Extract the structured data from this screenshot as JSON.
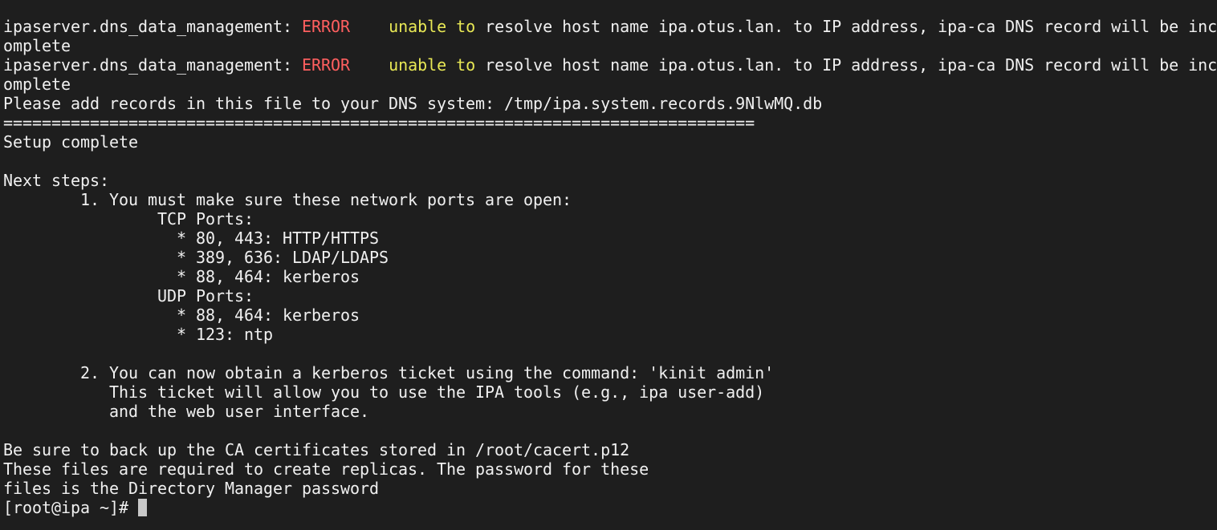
{
  "colors": {
    "background": "#1e1e1e",
    "foreground": "#f0f0f0",
    "error": "#ff5f5f",
    "warning": "#e8e855",
    "cursor": "#c8c8c8"
  },
  "lines": [
    {
      "type": "error",
      "prefix": "ipaserver.dns_data_management: ",
      "level": "ERROR",
      "gap": "    ",
      "warn": "unable to",
      "rest": " resolve host name ipa.otus.lan. to IP address, ipa-ca DNS record will be inc"
    },
    {
      "type": "plain",
      "text": "omplete"
    },
    {
      "type": "error",
      "prefix": "ipaserver.dns_data_management: ",
      "level": "ERROR",
      "gap": "    ",
      "warn": "unable to",
      "rest": " resolve host name ipa.otus.lan. to IP address, ipa-ca DNS record will be inc"
    },
    {
      "type": "plain",
      "text": "omplete"
    },
    {
      "type": "plain",
      "text": "Please add records in this file to your DNS system: /tmp/ipa.system.records.9NlwMQ.db"
    },
    {
      "type": "plain",
      "text": "=============================================================================="
    },
    {
      "type": "plain",
      "text": "Setup complete"
    },
    {
      "type": "plain",
      "text": ""
    },
    {
      "type": "plain",
      "text": "Next steps:"
    },
    {
      "type": "plain",
      "text": "        1. You must make sure these network ports are open:"
    },
    {
      "type": "plain",
      "text": "                TCP Ports:"
    },
    {
      "type": "plain",
      "text": "                  * 80, 443: HTTP/HTTPS"
    },
    {
      "type": "plain",
      "text": "                  * 389, 636: LDAP/LDAPS"
    },
    {
      "type": "plain",
      "text": "                  * 88, 464: kerberos"
    },
    {
      "type": "plain",
      "text": "                UDP Ports:"
    },
    {
      "type": "plain",
      "text": "                  * 88, 464: kerberos"
    },
    {
      "type": "plain",
      "text": "                  * 123: ntp"
    },
    {
      "type": "plain",
      "text": ""
    },
    {
      "type": "plain",
      "text": "        2. You can now obtain a kerberos ticket using the command: 'kinit admin'"
    },
    {
      "type": "plain",
      "text": "           This ticket will allow you to use the IPA tools (e.g., ipa user-add)"
    },
    {
      "type": "plain",
      "text": "           and the web user interface."
    },
    {
      "type": "plain",
      "text": ""
    },
    {
      "type": "plain",
      "text": "Be sure to back up the CA certificates stored in /root/cacert.p12"
    },
    {
      "type": "plain",
      "text": "These files are required to create replicas. The password for these"
    },
    {
      "type": "plain",
      "text": "files is the Directory Manager password"
    }
  ],
  "prompt": {
    "text": "[root@ipa ~]# "
  }
}
